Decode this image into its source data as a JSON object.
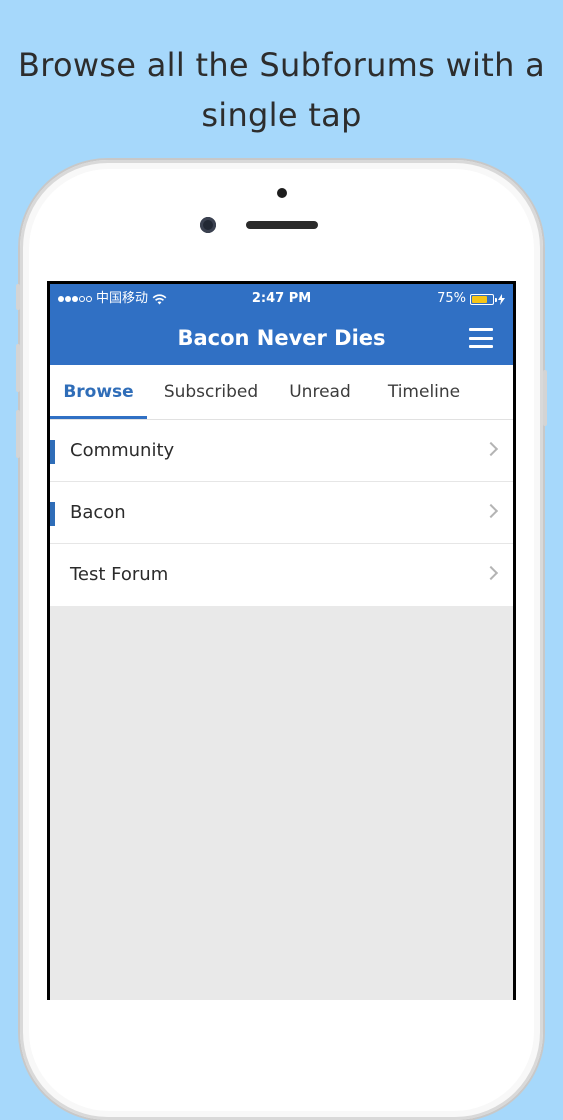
{
  "headline": {
    "line1": "Browse all the Subforums with a",
    "line2": "single tap"
  },
  "status_bar": {
    "carrier": "中国移动",
    "time": "2:47 PM",
    "battery_percent": "75%",
    "battery_level": 0.75,
    "battery_color": "#f5c518"
  },
  "nav": {
    "title": "Bacon Never Dies",
    "menu_icon": "hamburger-menu-icon",
    "background_color": "#3070c4"
  },
  "tabs": [
    {
      "label": "Browse",
      "active": true
    },
    {
      "label": "Subscribed",
      "active": false
    },
    {
      "label": "Unread",
      "active": false
    },
    {
      "label": "Timeline",
      "active": false
    }
  ],
  "forums": [
    {
      "label": "Community",
      "has_marker": true
    },
    {
      "label": "Bacon",
      "has_marker": true
    },
    {
      "label": "Test Forum",
      "has_marker": false
    }
  ],
  "colors": {
    "page_background": "#a6d8fb",
    "accent": "#2f6db8",
    "screen_background": "#e9e9e9"
  }
}
